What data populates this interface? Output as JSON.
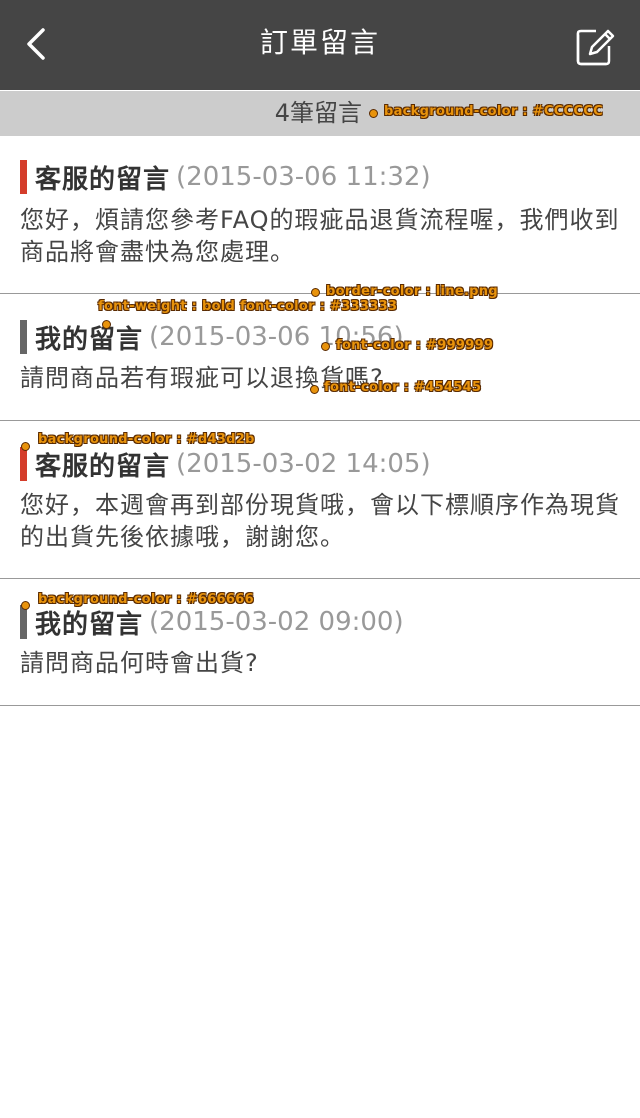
{
  "header": {
    "title": "訂單留言",
    "back_icon": "chevron-left-icon",
    "compose_icon": "edit-icon"
  },
  "count_bar": {
    "label": "4筆留言",
    "background": "#CCCCCC"
  },
  "annotations": {
    "count_bg": "background-color : #CCCCCC",
    "border": "border-color : line.png",
    "font_weight": "font-weight : bold   font-color : #333333",
    "time_color": "font-color : #999999",
    "body_color": "font-color : #454545",
    "service_bar": "background-color : #d43d2b",
    "mine_bar": "background-color : #666666"
  },
  "colors": {
    "header_bg": "#454545",
    "service_bar": "#d43d2b",
    "mine_bar": "#666666",
    "author": "#333333",
    "time": "#999999",
    "body": "#454545",
    "divider": "#999999"
  },
  "messages": [
    {
      "author": "客服的留言",
      "time": "(2015-03-06 11:32)",
      "body": "您好，煩請您參考FAQ的瑕疵品退貨流程喔，我們收到商品將會盡快為您處理。",
      "type": "service"
    },
    {
      "author": "我的留言",
      "time": "(2015-03-06 10:56)",
      "body": "請問商品若有瑕疵可以退換貨嗎?",
      "type": "mine"
    },
    {
      "author": "客服的留言",
      "time": "(2015-03-02 14:05)",
      "body": "您好，本週會再到部份現貨哦，會以下標順序作為現貨的出貨先後依據哦，謝謝您。",
      "type": "service"
    },
    {
      "author": "我的留言",
      "time": "(2015-03-02 09:00)",
      "body": "請問商品何時會出貨?",
      "type": "mine"
    }
  ]
}
